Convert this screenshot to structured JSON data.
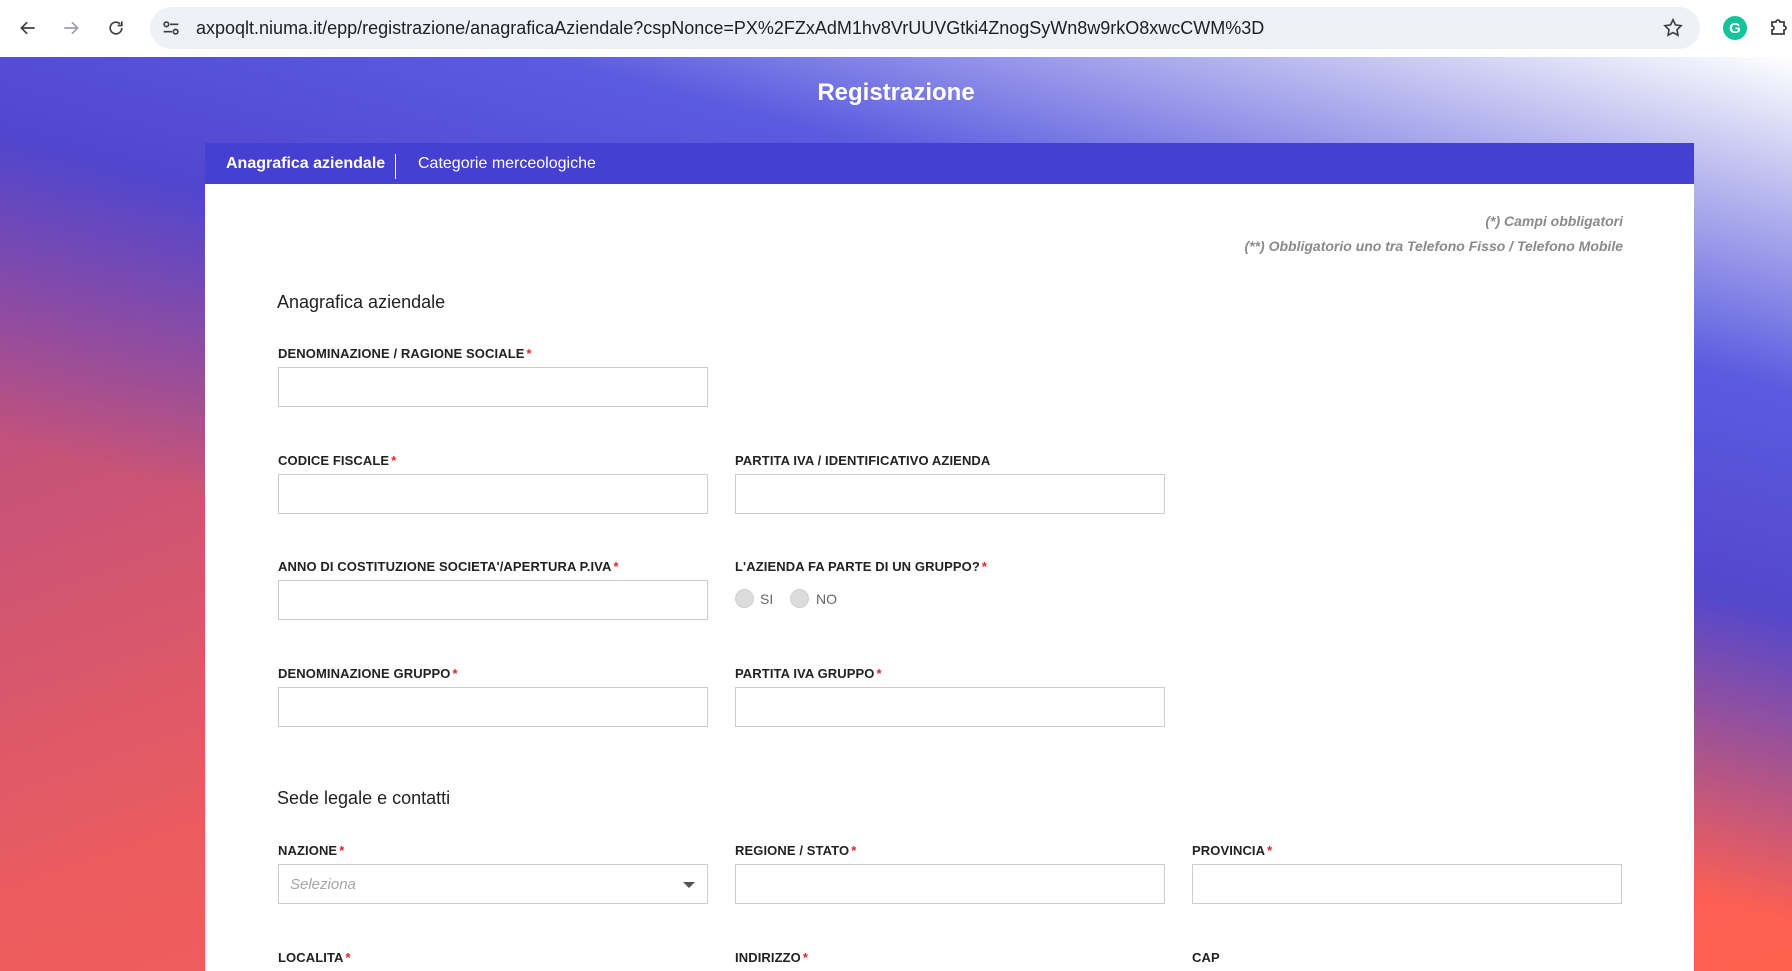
{
  "browser": {
    "url": "axpoqlt.niuma.it/epp/registrazione/anagraficaAziendale?cspNonce=PX%2FZxAdM1hv8VrUUVGtki4ZnogSyWn8w9rkO8xwcCWM%3D",
    "icons": [
      "back-arrow-icon",
      "forward-arrow-icon",
      "reload-icon",
      "site-info-icon",
      "bookmark-star-icon",
      "grammarly-icon",
      "extensions-puzzle-icon"
    ]
  },
  "page": {
    "title": "Registrazione",
    "tabs": [
      {
        "label": "Anagrafica aziendale",
        "active": true
      },
      {
        "label": "Categorie merceologiche",
        "active": false
      }
    ],
    "notes": {
      "required": "(*) Campi obbligatori",
      "phone_required": "(**) Obbligatorio uno tra Telefono Fisso / Telefono Mobile"
    },
    "required_mark": "*"
  },
  "anagrafica": {
    "section_title": "Anagrafica aziendale",
    "denominazione_label": "DENOMINAZIONE / RAGIONE SOCIALE",
    "codice_fiscale_label": "CODICE FISCALE",
    "partita_iva_label": "PARTITA IVA / IDENTIFICATIVO AZIENDA",
    "anno_costituzione_label": "ANNO DI COSTITUZIONE SOCIETA'/APERTURA P.IVA",
    "gruppo_question_label": "L'AZIENDA FA PARTE DI UN GRUPPO?",
    "gruppo_options": [
      "SI",
      "NO"
    ],
    "denominazione_gruppo_label": "DENOMINAZIONE GRUPPO",
    "partita_iva_gruppo_label": "PARTITA IVA GRUPPO"
  },
  "sede": {
    "section_title": "Sede legale e contatti",
    "nazione_label": "NAZIONE",
    "nazione_placeholder": "Seleziona",
    "regione_label": "REGIONE / STATO",
    "provincia_label": "PROVINCIA",
    "localita_label": "LOCALITA",
    "indirizzo_label": "INDIRIZZO",
    "cap_label": "CAP"
  },
  "colors": {
    "tab_bar": "#4540d1",
    "required": "#e02424",
    "grammarly": "#15c39a"
  }
}
